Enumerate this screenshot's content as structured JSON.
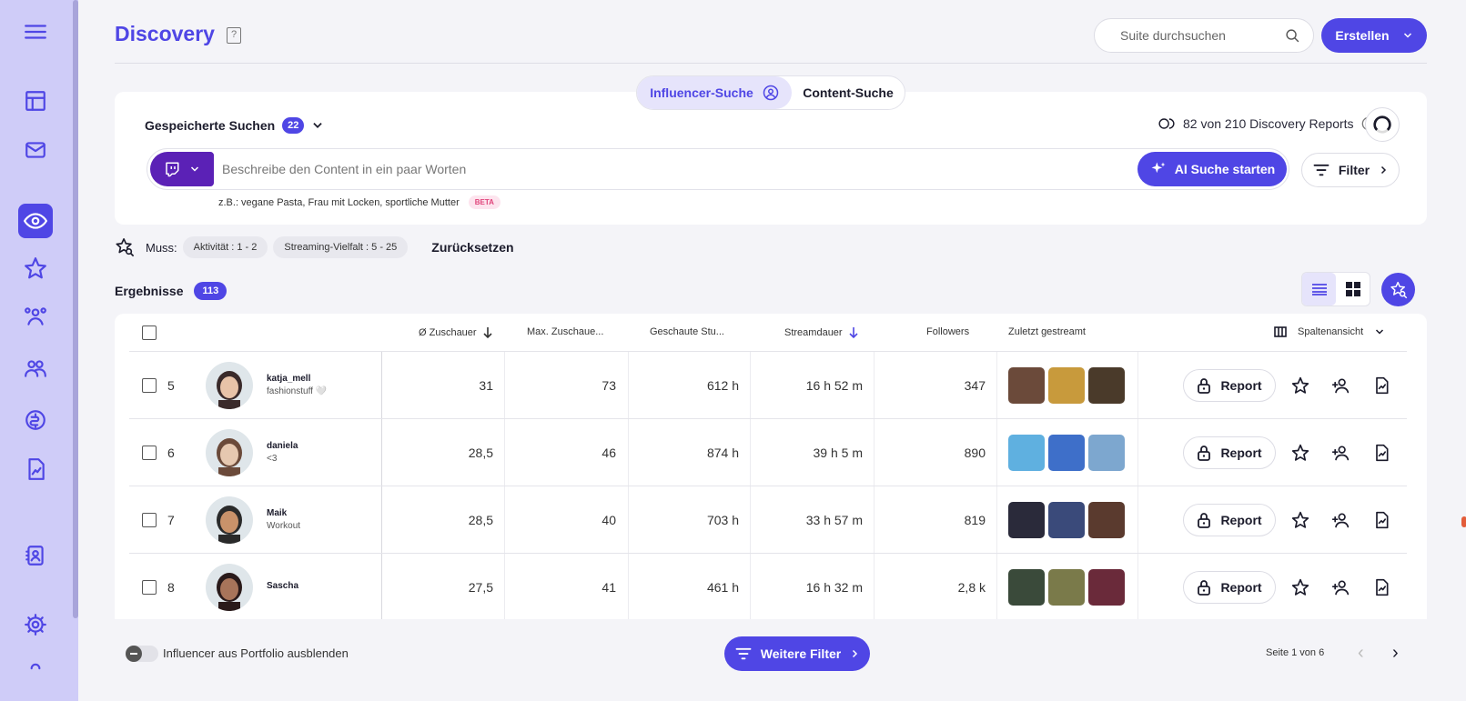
{
  "app": {
    "title": "Discovery",
    "help_icon": "help-book-icon"
  },
  "sidebar": {
    "items": [
      {
        "name": "menu",
        "icon": "hamburger-icon"
      },
      {
        "name": "dashboard",
        "icon": "layout-icon"
      },
      {
        "name": "inbox",
        "icon": "mail-icon"
      },
      {
        "name": "discovery",
        "icon": "eye-icon",
        "active": true
      },
      {
        "name": "favorites",
        "icon": "star-icon"
      },
      {
        "name": "influencer-network",
        "icon": "people-network-icon"
      },
      {
        "name": "teams",
        "icon": "users-icon"
      },
      {
        "name": "finance",
        "icon": "coin-icon"
      },
      {
        "name": "reports",
        "icon": "chart-doc-icon"
      },
      {
        "name": "contacts",
        "icon": "contact-book-icon"
      },
      {
        "name": "settings",
        "icon": "gear-icon"
      }
    ]
  },
  "header": {
    "search_placeholder": "Suite durchsuchen",
    "create_label": "Erstellen"
  },
  "search_tabs": {
    "influencer": "Influencer-Suche",
    "content": "Content-Suche"
  },
  "saved_searches": {
    "label": "Gespeicherte Suchen",
    "count": "22"
  },
  "reports_quota": {
    "text": "82 von 210 Discovery Reports"
  },
  "prompt": {
    "placeholder": "Beschreibe den Content in ein paar Worten",
    "ai_button": "AI Suche starten",
    "example": "z.B.: vegane Pasta, Frau mit Locken, sportliche Mutter",
    "beta": "BETA",
    "platform_icon": "twitch-icon"
  },
  "filter_button": "Filter",
  "must_filters": {
    "label": "Muss:",
    "chips": [
      "Aktivität : 1 - 2",
      "Streaming-Vielfalt : 5 - 25"
    ],
    "reset": "Zurücksetzen"
  },
  "results": {
    "label": "Ergebnisse",
    "count": "113"
  },
  "table": {
    "columns": {
      "viewers": "Ø Zuschauer",
      "max_viewers": "Max. Zuschaue...",
      "hours_watched": "Geschaute Stu...",
      "stream_duration": "Streamdauer",
      "followers": "Followers",
      "last_streamed": "Zuletzt gestreamt",
      "column_view": "Spaltenansicht"
    },
    "report_label": "Report",
    "rows": [
      {
        "rank": "5",
        "handle": "katja_mell",
        "bio": "fashionstuff 🤍",
        "viewers": "31",
        "max_viewers": "73",
        "hours_watched": "612 h",
        "stream_duration": "16 h 52 m",
        "followers": "347",
        "thumbs": [
          "#6b4a3a",
          "#c89a3c",
          "#4a3a2a"
        ]
      },
      {
        "rank": "6",
        "handle": "daniela",
        "bio": "<3",
        "viewers": "28,5",
        "max_viewers": "46",
        "hours_watched": "874 h",
        "stream_duration": "39 h 5 m",
        "followers": "890",
        "thumbs": [
          "#5fb0e0",
          "#3e6fc9",
          "#7da7cf"
        ]
      },
      {
        "rank": "7",
        "handle": "Maik",
        "bio": "Workout",
        "viewers": "28,5",
        "max_viewers": "40",
        "hours_watched": "703 h",
        "stream_duration": "33 h 57 m",
        "followers": "819",
        "thumbs": [
          "#2a2a3a",
          "#3a4a7a",
          "#5a3a2e"
        ]
      },
      {
        "rank": "8",
        "handle": "Sascha",
        "bio": "",
        "viewers": "27,5",
        "max_viewers": "41",
        "hours_watched": "461 h",
        "stream_duration": "16 h 32 m",
        "followers": "2,8 k",
        "thumbs": [
          "#3a4a3a",
          "#7a7a4a",
          "#6a2a3a"
        ]
      }
    ]
  },
  "footer": {
    "toggle_label": "Influencer aus Portfolio ausblenden",
    "more_filters": "Weitere Filter",
    "page_info": "Seite 1 von 6"
  },
  "colors": {
    "accent": "#4f46e5",
    "sidebar_bg": "#cfccf8",
    "twitch": "#5b21b6"
  }
}
